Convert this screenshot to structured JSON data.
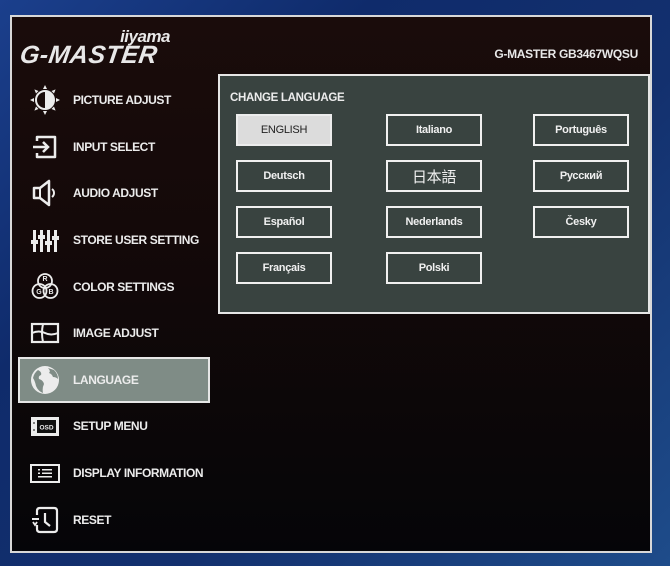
{
  "header": {
    "brand": "iiyama",
    "product_line": "G-MASTER",
    "model": "G-MASTER GB3467WQSU"
  },
  "sidebar": {
    "items": [
      {
        "label": "PICTURE ADJUST",
        "icon": "brightness-icon"
      },
      {
        "label": "INPUT SELECT",
        "icon": "input-icon"
      },
      {
        "label": "AUDIO ADJUST",
        "icon": "speaker-icon"
      },
      {
        "label": "STORE USER SETTING",
        "icon": "sliders-icon"
      },
      {
        "label": "COLOR SETTINGS",
        "icon": "rgb-icon"
      },
      {
        "label": "IMAGE ADJUST",
        "icon": "image-adjust-icon"
      },
      {
        "label": "LANGUAGE",
        "icon": "globe-icon",
        "selected": true
      },
      {
        "label": "SETUP MENU",
        "icon": "osd-icon"
      },
      {
        "label": "DISPLAY INFORMATION",
        "icon": "info-list-icon"
      },
      {
        "label": "RESET",
        "icon": "reset-clock-icon"
      }
    ],
    "rgb_letters": {
      "r": "R",
      "g": "G",
      "b": "B"
    },
    "osd_text": "OSD"
  },
  "panel": {
    "title": "CHANGE LANGUAGE",
    "selected": "ENGLISH",
    "languages": [
      {
        "label": "ENGLISH",
        "selected": true
      },
      {
        "label": "Deutsch"
      },
      {
        "label": "Español"
      },
      {
        "label": "Français"
      },
      {
        "label": "Italiano"
      },
      {
        "label": "日本語"
      },
      {
        "label": "Nederlands"
      },
      {
        "label": "Polski"
      },
      {
        "label": "Português"
      },
      {
        "label": "Русский"
      },
      {
        "label": "Česky"
      }
    ]
  },
  "colors": {
    "osd_background": "#140909",
    "panel_background": "#394340",
    "selected_item": "#7f8c86",
    "selected_button": "#dcdcdc",
    "text": "#ececec",
    "border": "#e6e6e6"
  }
}
